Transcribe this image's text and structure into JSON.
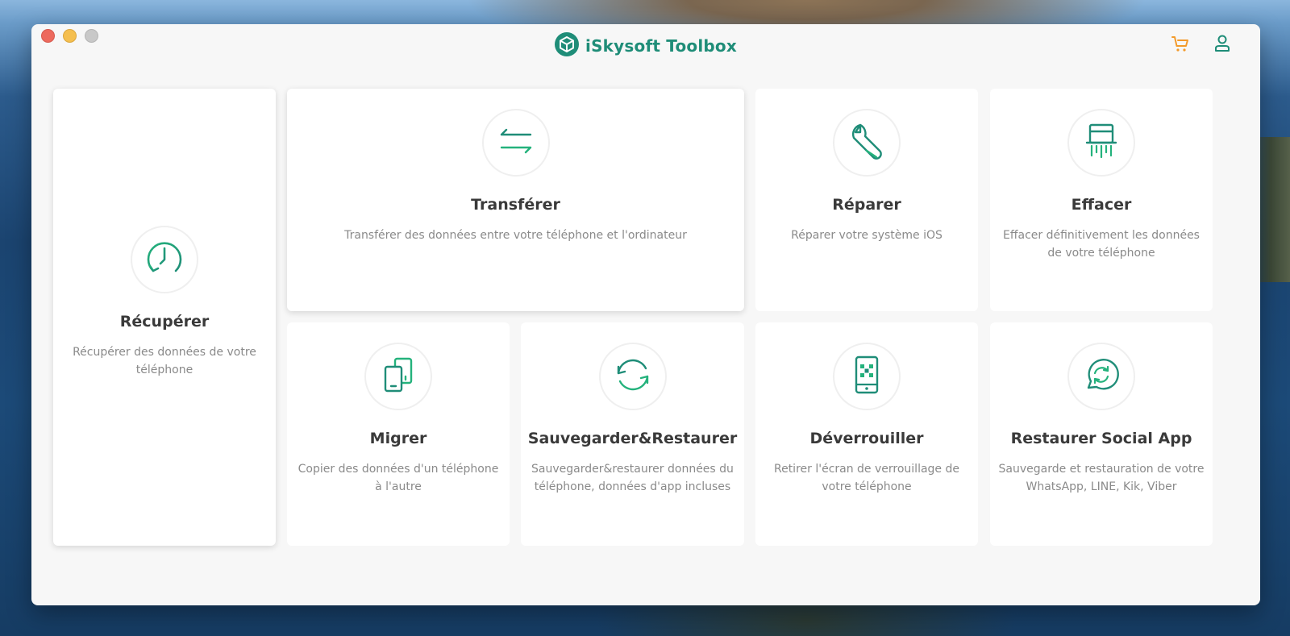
{
  "app": {
    "title": "iSkysoft Toolbox",
    "brand_color": "#1f8d78",
    "accent_orange": "#f39a2b"
  },
  "header": {
    "cart_icon": "cart-icon",
    "user_icon": "user-icon"
  },
  "cards": {
    "recuperer": {
      "title": "Récupérer",
      "desc": "Récupérer des données de votre téléphone",
      "icon": "clock-restore-icon"
    },
    "transferer": {
      "title": "Transférer",
      "desc": "Transférer des données entre votre téléphone et l'ordinateur",
      "icon": "transfer-arrows-icon"
    },
    "reparer": {
      "title": "Réparer",
      "desc": "Réparer votre système iOS",
      "icon": "wrench-icon"
    },
    "effacer": {
      "title": "Effacer",
      "desc": "Effacer définitivement les données de votre téléphone",
      "icon": "shredder-icon"
    },
    "migrer": {
      "title": "Migrer",
      "desc": "Copier des données d'un téléphone à l'autre",
      "icon": "phone-copy-icon"
    },
    "sauvegarder": {
      "title": "Sauvegarder&Restaurer",
      "desc": "Sauvegarder&restaurer données du téléphone, données d'app incluses",
      "icon": "sync-circle-icon"
    },
    "deverrouiller": {
      "title": "Déverrouiller",
      "desc": "Retirer l'écran de verrouillage de votre téléphone",
      "icon": "phone-unlock-icon"
    },
    "social": {
      "title": "Restaurer Social App",
      "desc": "Sauvegarde et restauration de votre WhatsApp, LINE, Kik, Viber",
      "icon": "chat-sync-icon"
    }
  }
}
